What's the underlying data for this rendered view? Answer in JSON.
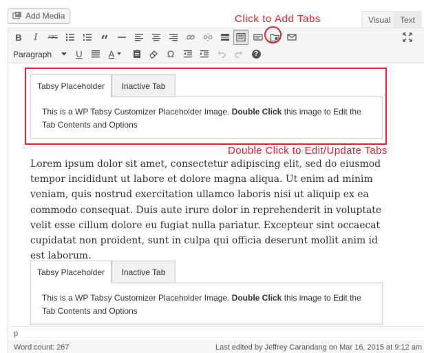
{
  "media_button": {
    "label": "Add Media",
    "icon": "media-icon"
  },
  "editor_tabs": {
    "visual": "Visual",
    "text": "Text"
  },
  "annotations": {
    "top": "Click to Add Tabs",
    "bottom": "Double Click to Edit/Update Tabs",
    "color": "#e8202d"
  },
  "toolbar": {
    "row1": [
      "bold",
      "italic",
      "strikethrough",
      "bulleted-list",
      "numbered-list",
      "blockquote",
      "horizontal-line",
      "align-left",
      "align-center",
      "align-right",
      "insert-link",
      "remove-link",
      "read-more",
      "tabsy",
      "add-tab",
      "folder-add",
      "mail",
      "fullscreen"
    ],
    "bold_glyph": "B",
    "italic_glyph": "I",
    "strike_glyph": "ABC",
    "format_select": "Paragraph",
    "underline_glyph": "U",
    "text_color_glyph": "A",
    "omega_glyph": "Ω",
    "help_glyph": "?"
  },
  "tabsy_blocks": [
    {
      "active_tab": "Tabsy Placeholder",
      "inactive_tab": "Inactive Tab",
      "text_before": "This is a WP Tabsy Customizer Placeholder Image. ",
      "text_bold": "Double Click",
      "text_after": " this image to Edit the Tab Contents and Options"
    },
    {
      "active_tab": "Tabsy Placeholder",
      "inactive_tab": "Inactive Tab",
      "text_before": "This is a WP Tabsy Customizer Placeholder Image. ",
      "text_bold": "Double Click",
      "text_after": " this image to Edit the Tab Contents and Options"
    }
  ],
  "body_text": "Lorem ipsum dolor sit amet, consectetur adipiscing elit, sed do eiusmod tempor incididunt ut labore et dolore magna aliqua. Ut enim ad minim veniam, quis nostrud exercitation ullamco laboris nisi ut aliquip ex ea commodo consequat. Duis aute irure dolor in reprehenderit in voluptate velit esse cillum dolore eu fugiat nulla pariatur. Excepteur sint occaecat cupidatat non proident, sunt in culpa qui officia deserunt mollit anim id est laborum.",
  "status": {
    "path": "p",
    "word_count": "Word count: 267",
    "last_edited": "Last edited by Jeffrey Carandang on Mar 16, 2015 at 9:12 am"
  }
}
